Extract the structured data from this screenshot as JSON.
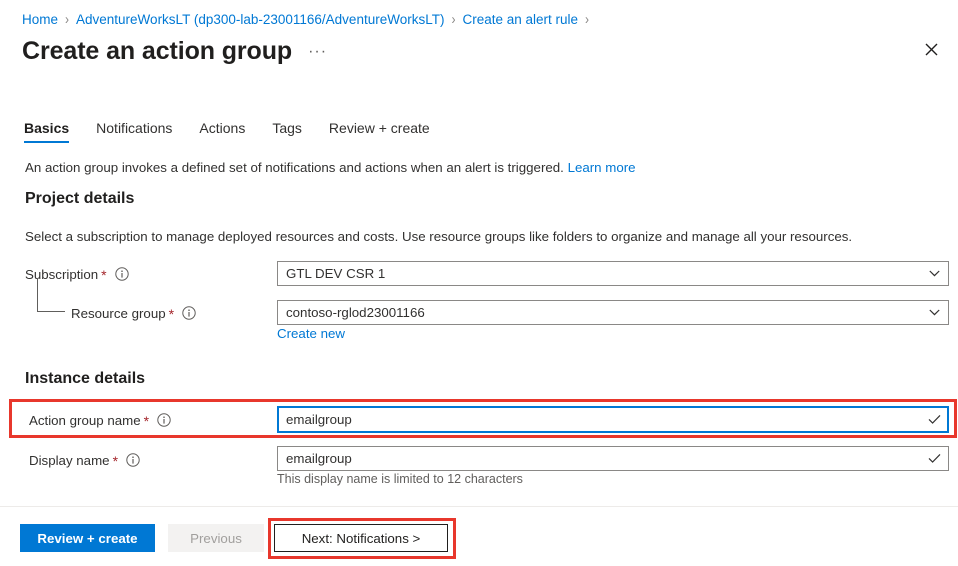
{
  "breadcrumb": {
    "items": [
      {
        "label": "Home"
      },
      {
        "label": "AdventureWorksLT (dp300-lab-23001166/AdventureWorksLT)"
      },
      {
        "label": "Create an alert rule"
      }
    ],
    "separator": "›"
  },
  "header": {
    "title": "Create an action group",
    "more_label": "···",
    "close_icon": "close-icon"
  },
  "tabs": [
    {
      "label": "Basics",
      "active": true
    },
    {
      "label": "Notifications",
      "active": false
    },
    {
      "label": "Actions",
      "active": false
    },
    {
      "label": "Tags",
      "active": false
    },
    {
      "label": "Review + create",
      "active": false
    }
  ],
  "description": {
    "text": "An action group invokes a defined set of notifications and actions when an alert is triggered.",
    "link_label": "Learn more"
  },
  "project_details": {
    "heading": "Project details",
    "subtext": "Select a subscription to manage deployed resources and costs. Use resource groups like folders to organize and manage all your resources.",
    "subscription": {
      "label": "Subscription",
      "required_marker": "*",
      "info_icon": "info-icon",
      "value": "GTL DEV CSR 1",
      "trailing_icon": "chevron-down-icon"
    },
    "resource_group": {
      "label": "Resource group",
      "required_marker": "*",
      "info_icon": "info-icon",
      "value": "contoso-rglod23001166",
      "trailing_icon": "chevron-down-icon",
      "create_new_label": "Create new"
    }
  },
  "instance_details": {
    "heading": "Instance details",
    "action_group_name": {
      "label": "Action group name",
      "required_marker": "*",
      "info_icon": "info-icon",
      "value": "emailgroup",
      "trailing_icon": "checkmark-icon"
    },
    "display_name": {
      "label": "Display name",
      "required_marker": "*",
      "info_icon": "info-icon",
      "value": "emailgroup",
      "trailing_icon": "checkmark-icon",
      "help_text": "This display name is limited to 12 characters"
    }
  },
  "footer": {
    "review_create_label": "Review + create",
    "previous_label": "Previous",
    "next_label": "Next: Notifications >"
  },
  "colors": {
    "accent_blue": "#0078d4",
    "required_red": "#a4262c",
    "annotation_red": "#e8372c",
    "border_grey": "#8a8886",
    "disabled_bg": "#f3f2f1",
    "disabled_text": "#a19f9d"
  }
}
